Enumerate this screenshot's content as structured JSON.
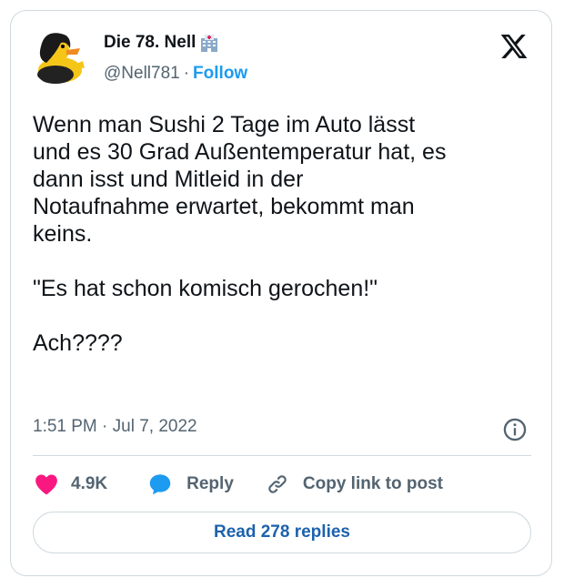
{
  "author": {
    "display_name": "Die 78. Nell",
    "handle": "@Nell781",
    "separator": "·",
    "follow_label": "Follow",
    "name_emoji_icon": "hospital-icon",
    "avatar_icon": "rubber-duck-avatar"
  },
  "platform_icon": "x-logo-icon",
  "tweet": {
    "text": "Wenn man Sushi 2 Tage im Auto lässt\nund es 30 Grad Außentemperatur hat, es\ndann isst und Mitleid in der\nNotaufnahme erwartet, bekommt man\nkeins.\n\n\"Es hat schon komisch gerochen!\"\n\nAch????",
    "timestamp": "1:51 PM · Jul 7, 2022"
  },
  "actions": {
    "like_count": "4.9K",
    "reply_label": "Reply",
    "copy_link_label": "Copy link to post"
  },
  "read_replies_label": "Read 278 replies",
  "colors": {
    "text": "#0f1419",
    "secondary": "#536471",
    "accent": "#1d9bf0",
    "like": "#f91880",
    "reply": "#1d9bf0",
    "border": "#cfd9de"
  }
}
